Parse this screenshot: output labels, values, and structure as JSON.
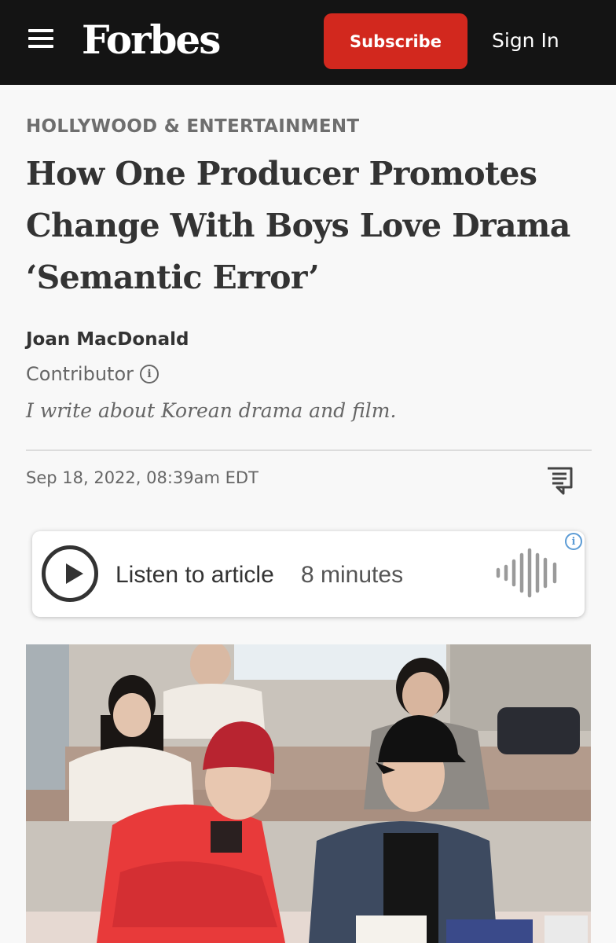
{
  "header": {
    "logo": "Forbes",
    "subscribe_label": "Subscribe",
    "signin_label": "Sign In"
  },
  "article": {
    "category": "HOLLYWOOD & ENTERTAINMENT",
    "headline": "How One Producer Promotes Change With Boys Love Drama ‘Semantic Error’",
    "author": "Joan MacDonald",
    "author_role": "Contributor",
    "author_bio": "I write about Korean drama and film.",
    "date": "Sep 18, 2022, 08:39am EDT"
  },
  "audio_player": {
    "label": "Listen to article",
    "duration": "8 minutes"
  },
  "icons": {
    "menu": "hamburger-menu-icon",
    "info": "info-icon",
    "comment": "comment-icon",
    "play": "play-icon",
    "waveform": "audio-waveform-icon"
  },
  "colors": {
    "topbar_bg": "#141414",
    "subscribe_bg": "#d2281e",
    "page_bg": "#f8f8f8",
    "info_accent": "#5b9bd5"
  }
}
